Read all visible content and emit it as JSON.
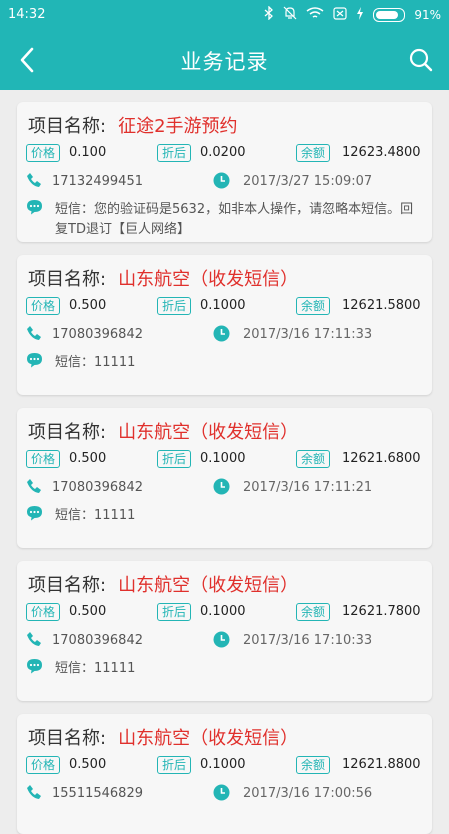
{
  "status": {
    "time": "14:32",
    "battery": "91%",
    "battery_level": 0.91
  },
  "header": {
    "title": "业务记录",
    "back_icon": "back-arrow-icon",
    "search_icon": "search-icon"
  },
  "labels": {
    "project": "项目名称:",
    "price": "价格",
    "discount": "折后",
    "balance": "余额"
  },
  "colors": {
    "accent": "#21b6b6",
    "project_name": "#e0302c",
    "card_bg": "#f7f7f7",
    "page_bg": "#ededed"
  },
  "records": [
    {
      "project": "征途2手游预约",
      "price": "0.100",
      "discount": "0.0200",
      "balance": "12623.4800",
      "phone": "17132499451",
      "time": "2017/3/27 15:09:07",
      "sms": "短信：您的验证码是5632，如非本人操作，请忽略本短信。回复TD退订【巨人网络】"
    },
    {
      "project": "山东航空（收发短信）",
      "price": "0.500",
      "discount": "0.1000",
      "balance": "12621.5800",
      "phone": "17080396842",
      "time": "2017/3/16 17:11:33",
      "sms": "短信：11111"
    },
    {
      "project": "山东航空（收发短信）",
      "price": "0.500",
      "discount": "0.1000",
      "balance": "12621.6800",
      "phone": "17080396842",
      "time": "2017/3/16 17:11:21",
      "sms": "短信：11111"
    },
    {
      "project": "山东航空（收发短信）",
      "price": "0.500",
      "discount": "0.1000",
      "balance": "12621.7800",
      "phone": "17080396842",
      "time": "2017/3/16 17:10:33",
      "sms": "短信：11111"
    },
    {
      "project": "山东航空（收发短信）",
      "price": "0.500",
      "discount": "0.1000",
      "balance": "12621.8800",
      "phone": "15511546829",
      "time": "2017/3/16 17:00:56",
      "sms": ""
    }
  ]
}
